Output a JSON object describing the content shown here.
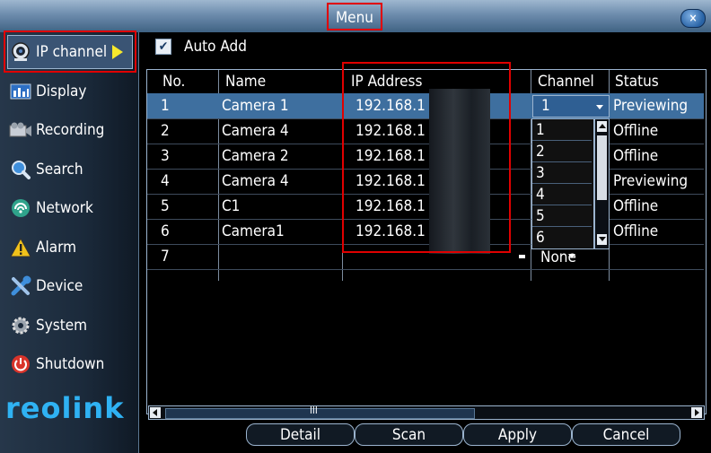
{
  "window": {
    "title": "Menu",
    "close_label": "×"
  },
  "sidebar": {
    "items": [
      {
        "label": "IP channel",
        "icon": "ip-camera-icon"
      },
      {
        "label": "Display",
        "icon": "display-icon"
      },
      {
        "label": "Recording",
        "icon": "recording-icon"
      },
      {
        "label": "Search",
        "icon": "search-icon"
      },
      {
        "label": "Network",
        "icon": "network-icon"
      },
      {
        "label": "Alarm",
        "icon": "alarm-icon"
      },
      {
        "label": "Device",
        "icon": "device-icon"
      },
      {
        "label": "System",
        "icon": "system-icon"
      },
      {
        "label": "Shutdown",
        "icon": "shutdown-icon"
      }
    ],
    "logo": "reolink"
  },
  "auto_add": {
    "label": "Auto Add",
    "checked": true
  },
  "table": {
    "headers": {
      "no": "No.",
      "name": "Name",
      "ip": "IP Address",
      "channel": "Channel",
      "status": "Status"
    },
    "rows": [
      {
        "no": "1",
        "name": "Camera 1",
        "ip": "192.168.1",
        "channel": "1",
        "status": "Previewing"
      },
      {
        "no": "2",
        "name": "Camera 4",
        "ip": "192.168.1",
        "channel": "",
        "status": "Offline"
      },
      {
        "no": "3",
        "name": "Camera 2",
        "ip": "192.168.1",
        "channel": "",
        "status": "Offline"
      },
      {
        "no": "4",
        "name": "Camera 4",
        "ip": "192.168.1",
        "channel": "",
        "status": "Previewing"
      },
      {
        "no": "5",
        "name": "C1",
        "ip": "192.168.1",
        "channel": "",
        "status": "Offline"
      },
      {
        "no": "6",
        "name": "Camera1",
        "ip": "192.168.1",
        "channel": "",
        "status": "Offline"
      },
      {
        "no": "7",
        "name": "",
        "ip": "",
        "channel": "None",
        "status": ""
      }
    ]
  },
  "channel_dropdown": {
    "options": [
      "1",
      "2",
      "3",
      "4",
      "5",
      "6"
    ],
    "selected": "1"
  },
  "hscroll_label": "III",
  "buttons": {
    "detail": "Detail",
    "scan": "Scan",
    "apply": "Apply",
    "cancel": "Cancel"
  }
}
